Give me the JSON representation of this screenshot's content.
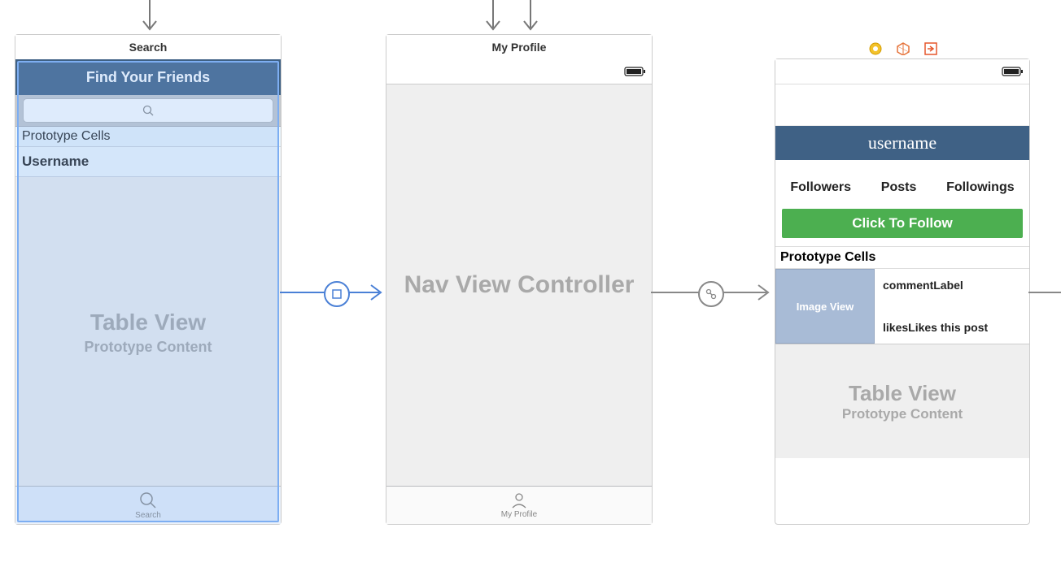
{
  "sceneA": {
    "title": "Search",
    "nav_title": "Find Your Friends",
    "proto_header": "Prototype Cells",
    "cell_label": "Username",
    "placeholder_title": "Table View",
    "placeholder_sub": "Prototype Content",
    "tab_label": "Search"
  },
  "sceneB": {
    "title": "My Profile",
    "center_text": "Nav View Controller",
    "tab_label": "My Profile"
  },
  "sceneC": {
    "username": "username",
    "stats": {
      "followers": "Followers",
      "posts": "Posts",
      "followings": "Followings"
    },
    "follow_btn": "Click To Follow",
    "proto_header": "Prototype Cells",
    "image_view": "Image View",
    "comment_label": "commentLabel",
    "likes_label_1": "likes",
    "likes_label_2": "Likes this post",
    "placeholder_title": "Table View",
    "placeholder_sub": "Prototype Content"
  }
}
